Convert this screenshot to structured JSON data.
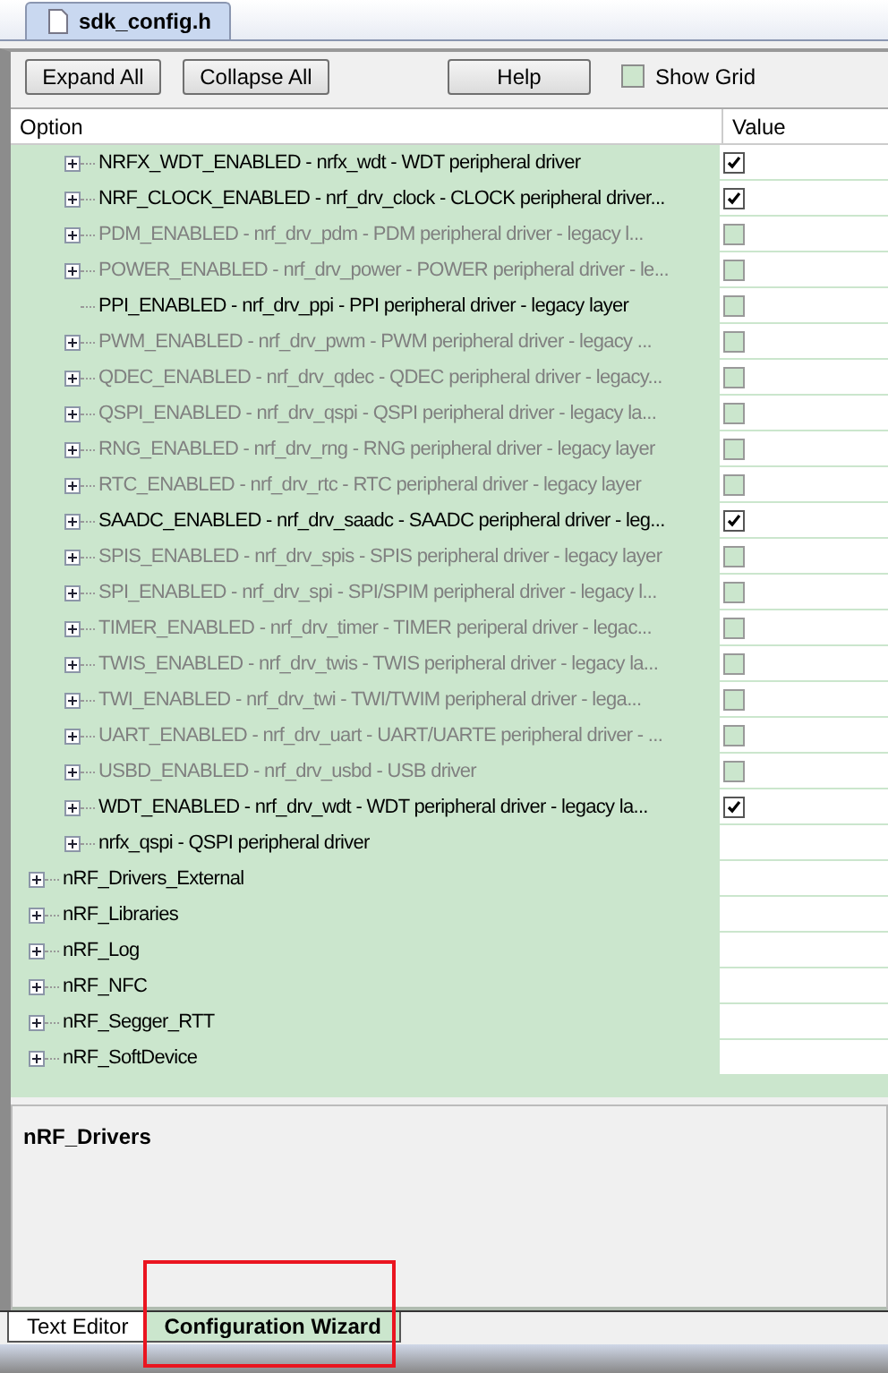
{
  "file_tab": {
    "label": "sdk_config.h"
  },
  "toolbar": {
    "buttons": [
      "Expand All",
      "Collapse All",
      "Help"
    ],
    "show_grid": {
      "label": "Show Grid",
      "checked": false
    }
  },
  "table": {
    "columns": [
      "Option",
      "Value"
    ],
    "rows": [
      {
        "children": [
          {
            "label": "NRFX_WDT_ENABLED - nrfx_wdt - WDT peripheral driver",
            "expandable": true,
            "dimmed": false,
            "kind": "option",
            "checked": true
          },
          {
            "label": "NRF_CLOCK_ENABLED - nrf_drv_clock - CLOCK peripheral driver...",
            "expandable": true,
            "dimmed": false,
            "kind": "option",
            "checked": true
          },
          {
            "label": "PDM_ENABLED - nrf_drv_pdm - PDM peripheral driver - legacy l...",
            "expandable": true,
            "dimmed": true,
            "kind": "option",
            "checked": false
          },
          {
            "label": "POWER_ENABLED - nrf_drv_power - POWER peripheral driver - le...",
            "expandable": true,
            "dimmed": true,
            "kind": "option",
            "checked": false
          },
          {
            "label": "PPI_ENABLED  - nrf_drv_ppi - PPI peripheral driver - legacy layer",
            "expandable": false,
            "dimmed": false,
            "kind": "option",
            "checked": false
          },
          {
            "label": "PWM_ENABLED - nrf_drv_pwm - PWM peripheral driver - legacy ...",
            "expandable": true,
            "dimmed": true,
            "kind": "option",
            "checked": false
          },
          {
            "label": "QDEC_ENABLED - nrf_drv_qdec - QDEC peripheral driver - legacy...",
            "expandable": true,
            "dimmed": true,
            "kind": "option",
            "checked": false
          },
          {
            "label": "QSPI_ENABLED - nrf_drv_qspi - QSPI peripheral driver - legacy la...",
            "expandable": true,
            "dimmed": true,
            "kind": "option",
            "checked": false
          },
          {
            "label": "RNG_ENABLED - nrf_drv_rng - RNG peripheral driver - legacy layer",
            "expandable": true,
            "dimmed": true,
            "kind": "option",
            "checked": false
          },
          {
            "label": "RTC_ENABLED - nrf_drv_rtc - RTC peripheral driver - legacy layer",
            "expandable": true,
            "dimmed": true,
            "kind": "option",
            "checked": false
          },
          {
            "label": "SAADC_ENABLED - nrf_drv_saadc - SAADC peripheral driver - leg...",
            "expandable": true,
            "dimmed": false,
            "kind": "option",
            "checked": true
          },
          {
            "label": "SPIS_ENABLED - nrf_drv_spis - SPIS peripheral driver - legacy layer",
            "expandable": true,
            "dimmed": true,
            "kind": "option",
            "checked": false
          },
          {
            "label": "SPI_ENABLED - nrf_drv_spi - SPI/SPIM peripheral driver - legacy l...",
            "expandable": true,
            "dimmed": true,
            "kind": "option",
            "checked": false
          },
          {
            "label": "TIMER_ENABLED - nrf_drv_timer - TIMER periperal driver - legac...",
            "expandable": true,
            "dimmed": true,
            "kind": "option",
            "checked": false
          },
          {
            "label": "TWIS_ENABLED - nrf_drv_twis - TWIS peripheral driver - legacy la...",
            "expandable": true,
            "dimmed": true,
            "kind": "option",
            "checked": false
          },
          {
            "label": "TWI_ENABLED - nrf_drv_twi - TWI/TWIM peripheral driver - lega...",
            "expandable": true,
            "dimmed": true,
            "kind": "option",
            "checked": false
          },
          {
            "label": "UART_ENABLED - nrf_drv_uart - UART/UARTE peripheral driver - ...",
            "expandable": true,
            "dimmed": true,
            "kind": "option",
            "checked": false
          },
          {
            "label": "USBD_ENABLED - nrf_drv_usbd - USB driver",
            "expandable": true,
            "dimmed": true,
            "kind": "option",
            "checked": false
          },
          {
            "label": "WDT_ENABLED - nrf_drv_wdt - WDT peripheral driver - legacy la...",
            "expandable": true,
            "dimmed": false,
            "kind": "option",
            "checked": true
          },
          {
            "label": "nrfx_qspi - QSPI peripheral driver",
            "expandable": true,
            "dimmed": false,
            "kind": "group"
          }
        ]
      },
      {
        "label": "nRF_Drivers_External",
        "expandable": true,
        "dimmed": false,
        "kind": "group"
      },
      {
        "label": "nRF_Libraries",
        "expandable": true,
        "dimmed": false,
        "kind": "group"
      },
      {
        "label": "nRF_Log",
        "expandable": true,
        "dimmed": false,
        "kind": "group"
      },
      {
        "label": "nRF_NFC",
        "expandable": true,
        "dimmed": false,
        "kind": "group"
      },
      {
        "label": "nRF_Segger_RTT",
        "expandable": true,
        "dimmed": false,
        "kind": "group"
      },
      {
        "label": "nRF_SoftDevice",
        "expandable": true,
        "dimmed": false,
        "kind": "group"
      }
    ]
  },
  "description": {
    "title": "nRF_Drivers"
  },
  "bottom_tabs": [
    {
      "label": "Text Editor",
      "selected": false
    },
    {
      "label": "Configuration Wizard",
      "selected": true
    }
  ]
}
